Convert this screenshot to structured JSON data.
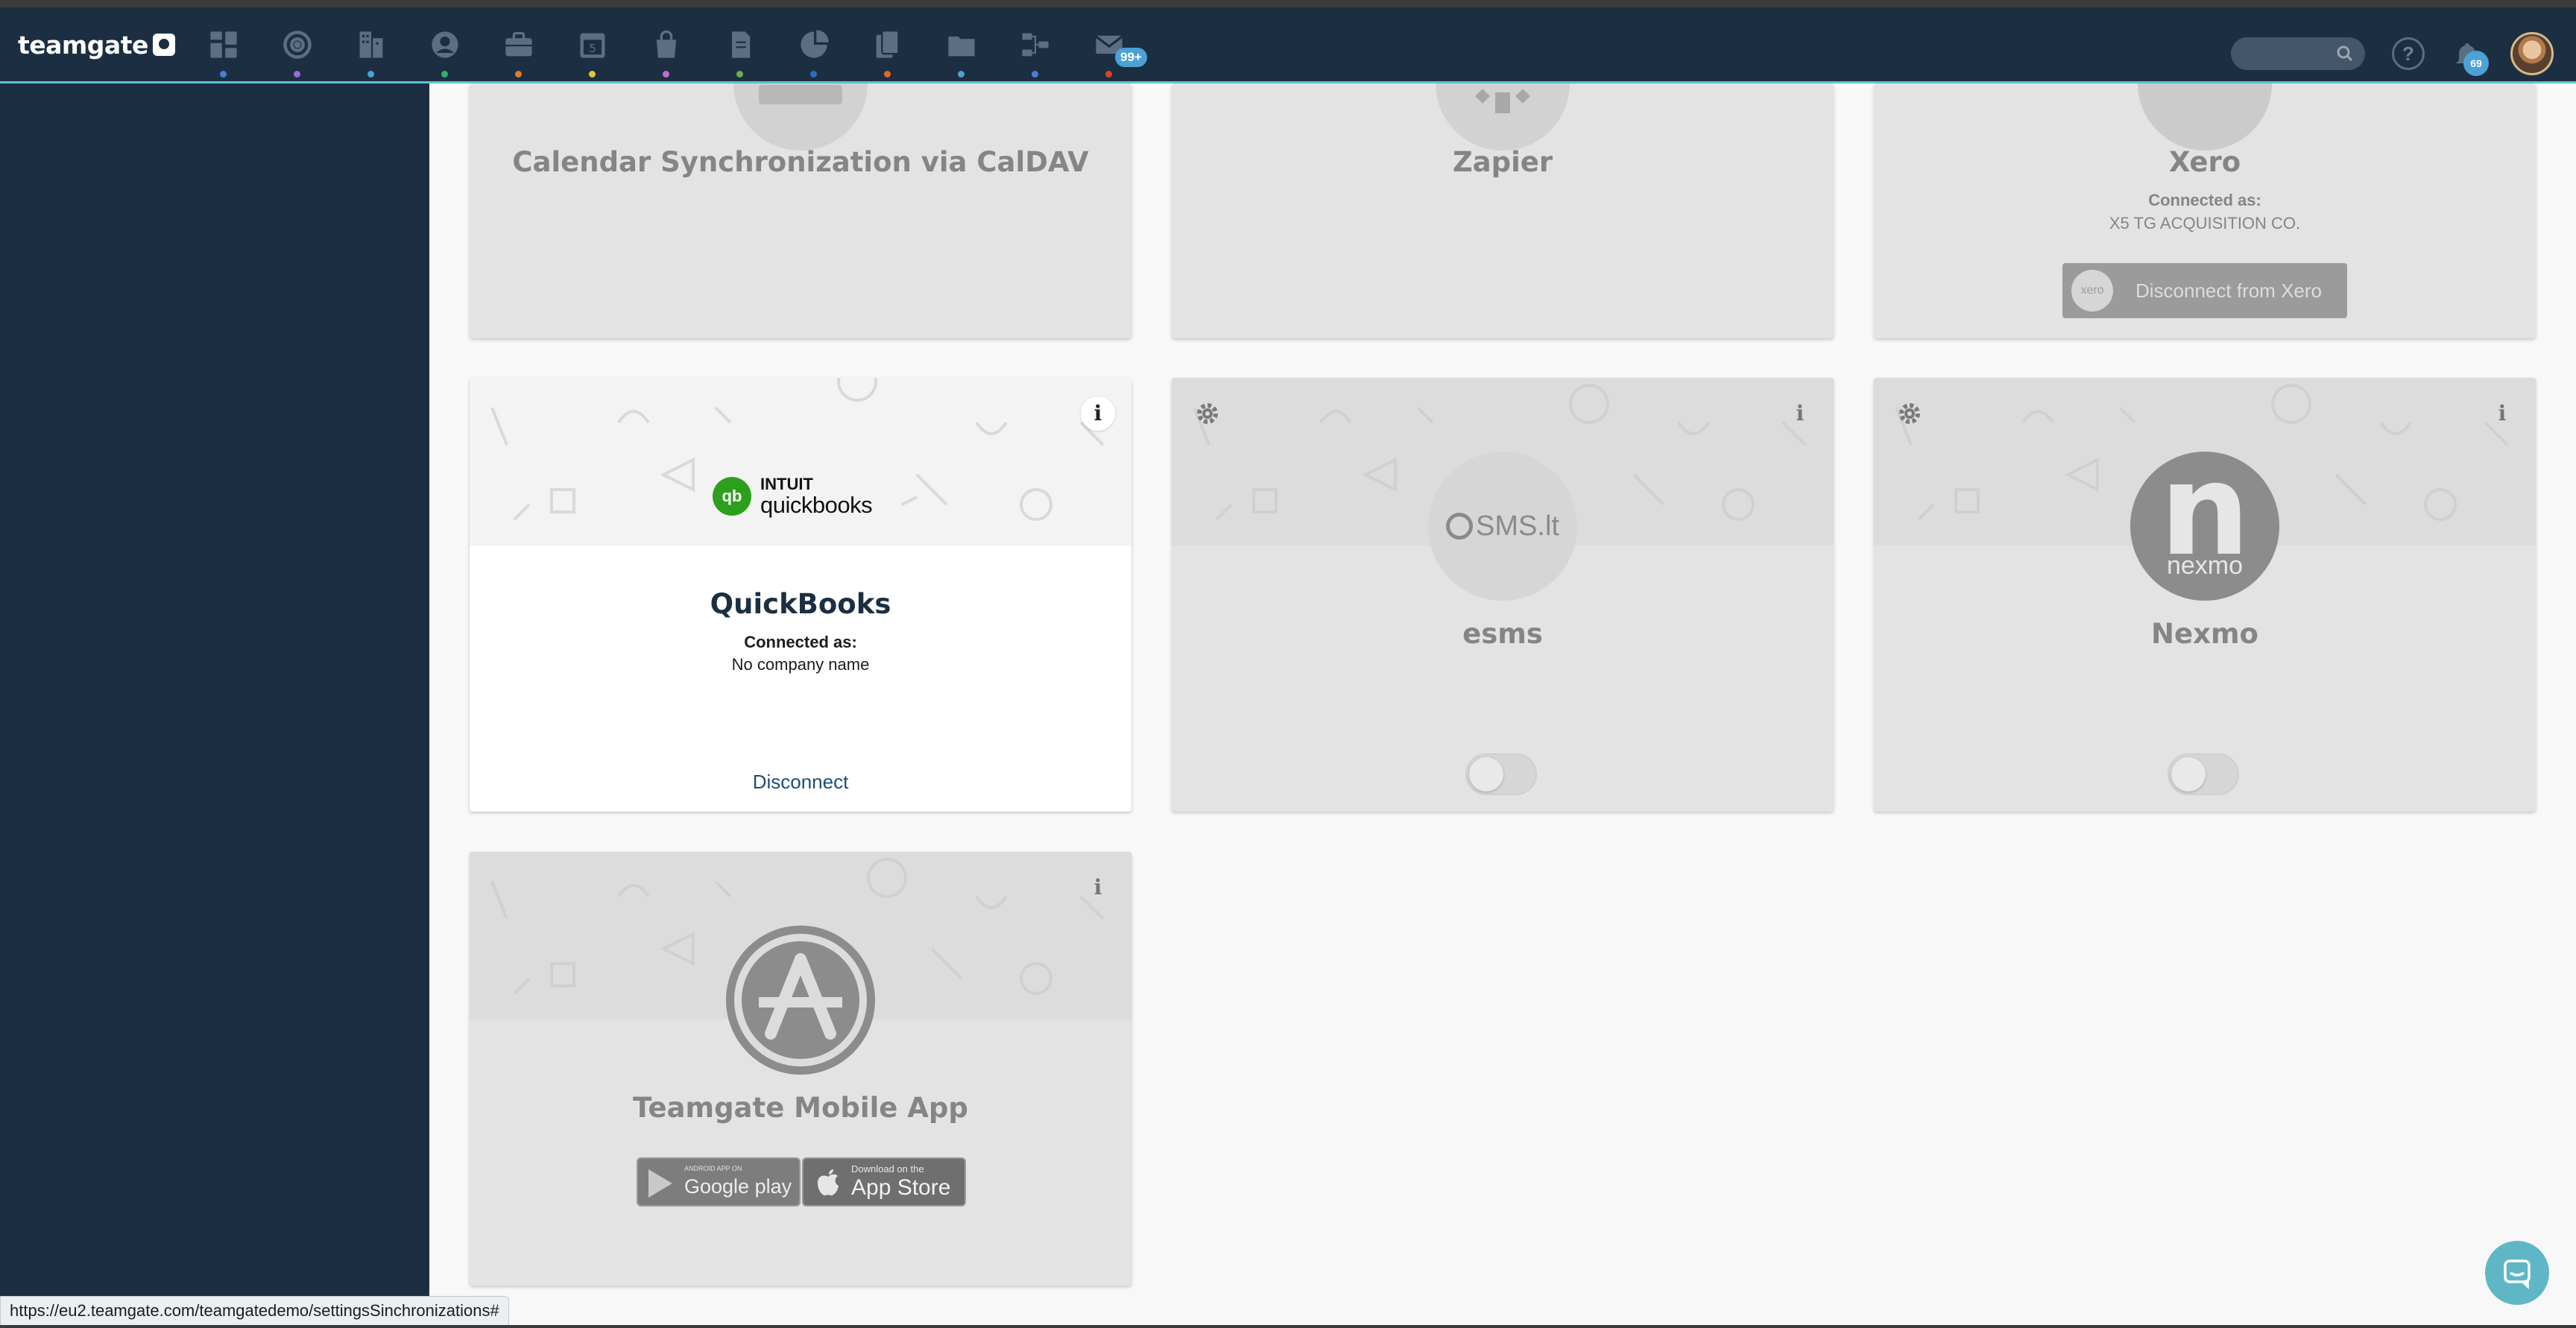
{
  "app": {
    "name": "teamgate"
  },
  "nav": {
    "icons": [
      {
        "name": "dashboard-icon",
        "dot": "#4a7fd6"
      },
      {
        "name": "target-icon",
        "dot": "#9b6ad6"
      },
      {
        "name": "companies-icon",
        "dot": "#4da1d6"
      },
      {
        "name": "contacts-icon",
        "dot": "#2fb36b"
      },
      {
        "name": "deals-icon",
        "dot": "#e07b2b"
      },
      {
        "name": "calendar-icon",
        "dot": "#e8c23a"
      },
      {
        "name": "products-icon",
        "dot": "#c86ad0"
      },
      {
        "name": "invoices-icon",
        "dot": "#6ab04c"
      },
      {
        "name": "reports-icon",
        "dot": "#2a6fc0"
      },
      {
        "name": "documents-icon",
        "dot": "#e0682b"
      },
      {
        "name": "files-icon",
        "dot": "#4da1d6"
      },
      {
        "name": "workflow-icon",
        "dot": "#4a7fd6"
      },
      {
        "name": "mail-icon",
        "dot": "#e0402b",
        "badge": "99+"
      }
    ],
    "calendar_day": "5",
    "notifications_count": "69",
    "help_label": "?"
  },
  "cards": {
    "caldav": {
      "title": "Calendar Synchronization via CalDAV"
    },
    "zapier": {
      "title": "Zapier"
    },
    "xero": {
      "title": "Xero",
      "connected_label": "Connected as:",
      "connected_value": "X5 TG ACQUISITION CO.",
      "disconnect_label": "Disconnect from Xero",
      "logo_text": "xero"
    },
    "quickbooks": {
      "title": "QuickBooks",
      "connected_label": "Connected as:",
      "connected_value": "No company name",
      "disconnect_label": "Disconnect",
      "logo_top": "INTUIT",
      "logo_bottom": "quickbooks",
      "logo_mark": "qb"
    },
    "esms": {
      "title": "esms",
      "logo_text": "SMS.lt",
      "enabled": false
    },
    "nexmo": {
      "title": "Nexmo",
      "logo_letter": "n",
      "logo_word": "nexmo",
      "enabled": false
    },
    "mobile": {
      "title": "Teamgate Mobile App",
      "google_small": "ANDROID APP ON",
      "google_big": "Google play",
      "apple_small": "Download on the",
      "apple_big": "App Store"
    },
    "info_label": "i"
  },
  "status_url": "https://eu2.teamgate.com/teamgatedemo/settingsSinchronizations#",
  "colors": {
    "topbar": "#1c2f42",
    "accent": "#5cc6cf",
    "badge": "#4da1d6"
  }
}
